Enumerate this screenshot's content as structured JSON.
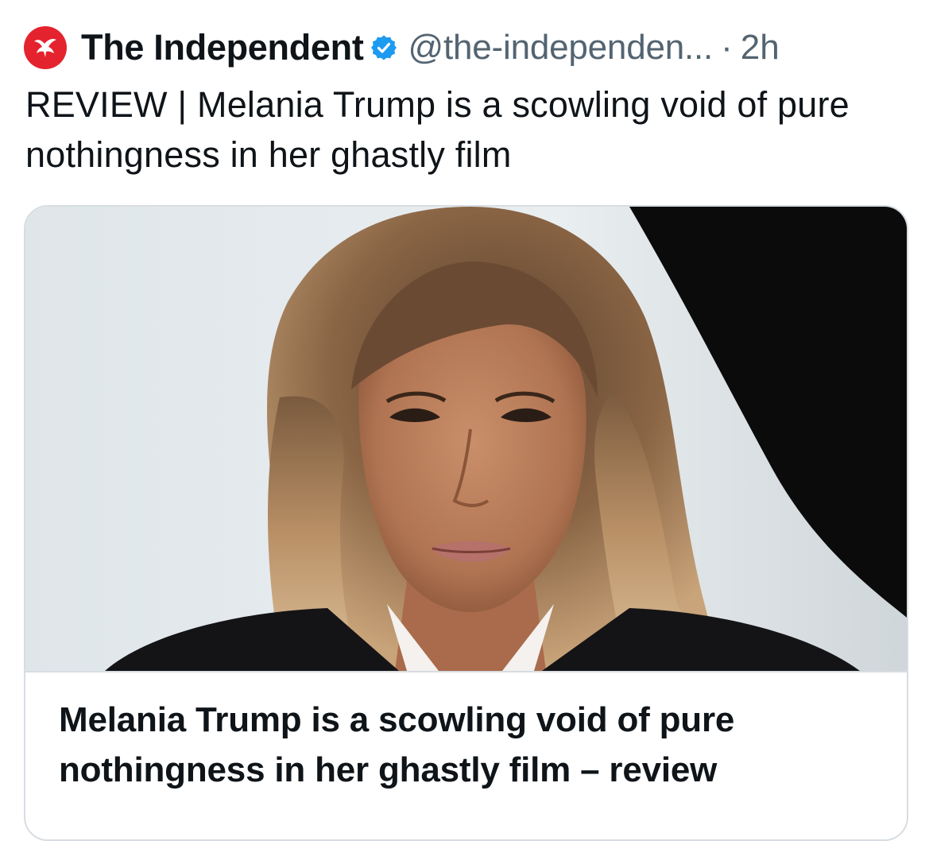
{
  "post": {
    "author_name": "The Independent",
    "handle": "@the-independen...",
    "separator": "·",
    "time": "2h",
    "text": "REVIEW | Melania Trump is a scowling void of pure nothingness in her ghastly film"
  },
  "link_card": {
    "title": "Melania Trump is a scowling void of pure nothingness in her ghastly film – review"
  },
  "icons": {
    "avatar": "eagle-logo-icon",
    "verified": "verified-badge-icon"
  },
  "colors": {
    "brand_red": "#e4232e",
    "verified_blue": "#1d9bf0",
    "secondary_text": "#536471",
    "primary_text": "#0f1419",
    "card_border": "#d7dde2"
  }
}
